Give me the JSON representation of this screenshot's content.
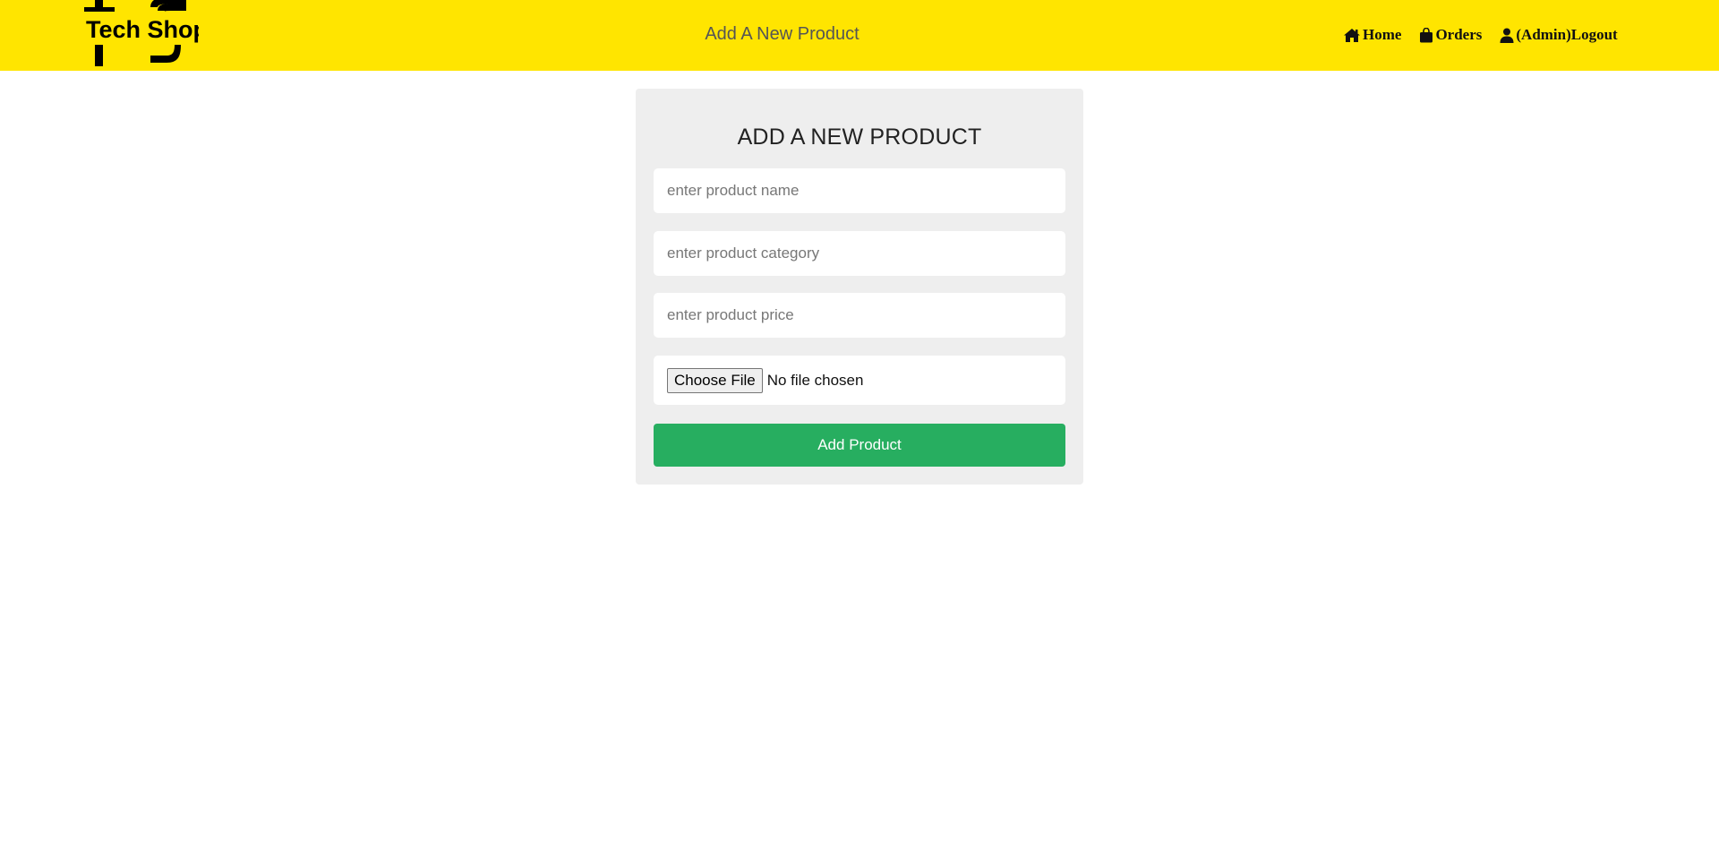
{
  "header": {
    "logo_text": "Tech Shop",
    "title": "Add A New Product",
    "nav": {
      "home": "Home",
      "orders": "Orders",
      "logout": "(Admin)Logout"
    }
  },
  "form": {
    "heading": "ADD A NEW PRODUCT",
    "name_placeholder": "enter product name",
    "category_placeholder": "enter product category",
    "price_placeholder": "enter product price",
    "file_button": "Choose File",
    "file_status": "No file chosen",
    "submit_label": "Add Product"
  },
  "colors": {
    "navbar": "#ffe500",
    "card": "#eeeeee",
    "submit": "#27ae60"
  },
  "icons": {
    "home": "home-icon",
    "orders": "shopping-bag-icon",
    "logout": "user-icon"
  }
}
